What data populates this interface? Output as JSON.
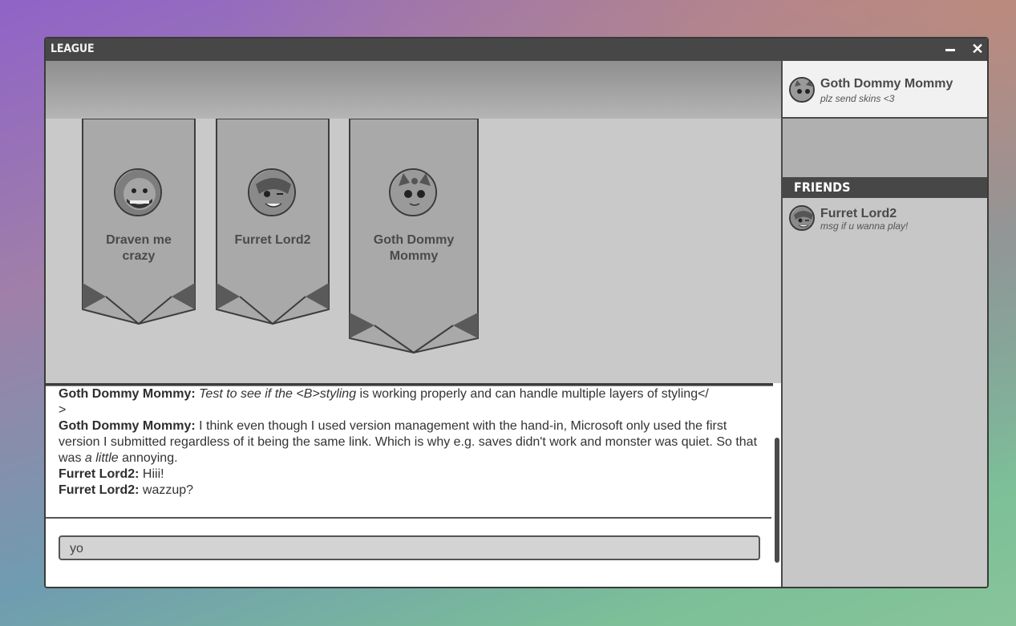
{
  "window": {
    "title": "LEAGUE",
    "minimize_label": "—",
    "close_label": "✕"
  },
  "lobby": {
    "members": [
      {
        "name": "Draven me crazy",
        "avatar": "draven-avatar-icon"
      },
      {
        "name": "Furret Lord2",
        "avatar": "furret-avatar-icon"
      },
      {
        "name": "Goth Dommy Mommy",
        "avatar": "goth-avatar-icon"
      }
    ]
  },
  "chat": {
    "messages": [
      {
        "sender": "Goth Dommy Mommy:",
        "parts": [
          "Test to see if the <B>styling",
          " is working properly and can handle multiple layers of styling</",
          ">"
        ]
      },
      {
        "sender": "Goth Dommy Mommy:",
        "parts": [
          "I think even though I used version management with the hand-in, Microsoft only used the first version I submitted regardless of it being the same link. Which is why e.g. saves didn't work and monster was quiet. So that was ",
          "a little",
          " annoying."
        ]
      },
      {
        "sender": "Furret Lord2:",
        "text": "Hiii!"
      },
      {
        "sender": "Furret Lord2:",
        "text": "wazzup?"
      }
    ],
    "input_value": "yo"
  },
  "profile": {
    "name": "Goth Dommy Mommy",
    "status": "plz send skins <3"
  },
  "friends": {
    "heading": "FRIENDS",
    "items": [
      {
        "name": "Furret Lord2",
        "status": "msg if u wanna play!"
      }
    ]
  },
  "colors": {
    "window_bg": "#ffffff",
    "titlebar": "#474747",
    "banner_area": "#c9c9c9",
    "banner": "#a9a9a9",
    "sidebar": "#b0b0b0"
  }
}
